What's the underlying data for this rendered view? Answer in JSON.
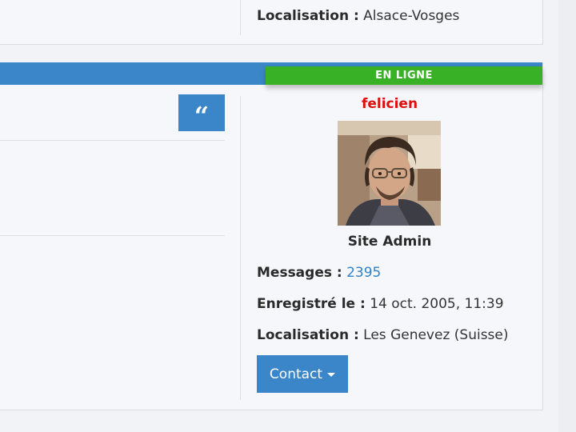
{
  "previous_post": {
    "location_label": "Localisation :",
    "location_value": "Alsace-Vosges"
  },
  "post": {
    "status_badge": "EN LIGNE",
    "quote_label": "“",
    "author": {
      "username": "felicien",
      "rank": "Site Admin",
      "messages_label": "Messages :",
      "messages_value": "2395",
      "joined_label": "Enregistré le :",
      "joined_value": "14 oct. 2005, 11:39",
      "location_label": "Localisation :",
      "location_value": "Les Genevez (Suisse)",
      "contact_label": "Contact"
    }
  },
  "colors": {
    "accent": "#3a86c8",
    "online": "#39b127",
    "username": "#e00d0d",
    "link": "#2f82c6"
  }
}
